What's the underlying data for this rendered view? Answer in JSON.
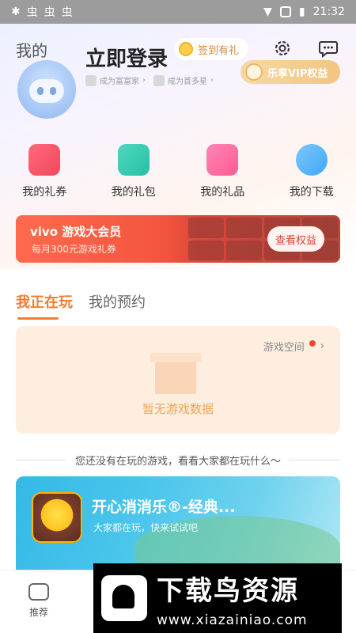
{
  "status_bar": {
    "time": "21:32",
    "indicators": [
      "虫",
      "虫",
      "虫"
    ]
  },
  "header": {
    "my_label": "我的",
    "login_title": "立即登录",
    "signin": "签到有礼",
    "badges": [
      "成为富富家",
      "成为首多星"
    ],
    "vip": "乐享VIP权益",
    "icons": [
      "settings-gear-icon",
      "message-bubble-icon"
    ]
  },
  "shortcuts": [
    {
      "label": "我的礼券",
      "icon": "coupon-icon",
      "color": "#f2475c"
    },
    {
      "label": "我的礼包",
      "icon": "gift-package-icon",
      "color": "#27c0a6"
    },
    {
      "label": "我的礼品",
      "icon": "gift-bag-icon",
      "color": "#ff5a93"
    },
    {
      "label": "我的下载",
      "icon": "download-cloud-icon",
      "color": "#3fa9f5"
    }
  ],
  "banner": {
    "title": "vivo 游戏大会员",
    "subtitle": "每月300元游戏礼券",
    "button": "查看权益"
  },
  "tabs": [
    {
      "label": "我正在玩",
      "active": true
    },
    {
      "label": "我的预约",
      "active": false
    }
  ],
  "empty_card": {
    "space_link": "游戏空间",
    "empty_text": "暂无游戏数据"
  },
  "suggest_text": "您还没有在玩的游戏，看看大家都在玩什么～",
  "game_card": {
    "title": "开心消消乐®-经典...",
    "subtitle": "大家都在玩，快来试试吧"
  },
  "bottom_nav": {
    "recommend": "推荐"
  },
  "watermark": {
    "title": "下载鸟资源",
    "url": "www.xiazainiao.com"
  }
}
